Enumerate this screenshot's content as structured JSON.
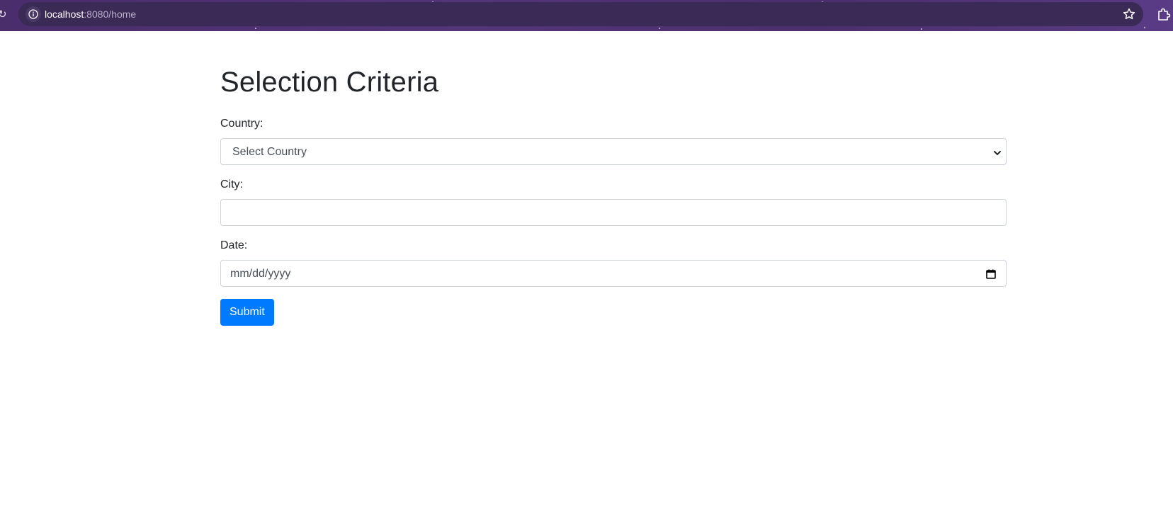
{
  "browser": {
    "url_host": "localhost",
    "url_rest": ":8080/home",
    "icons": {
      "reload": "reload-icon",
      "site_info": "info-icon",
      "bookmark": "star-icon",
      "extensions": "puzzle-icon"
    },
    "theme_color": "#4a2d6b"
  },
  "page": {
    "title": "Selection Criteria",
    "form": {
      "country": {
        "label": "Country:",
        "selected": "Select Country"
      },
      "city": {
        "label": "City:",
        "value": ""
      },
      "date": {
        "label": "Date:",
        "placeholder": "mm/dd/yyyy"
      },
      "submit_label": "Submit"
    },
    "colors": {
      "primary": "#007bff",
      "text": "#212529",
      "border": "#ced4da"
    }
  }
}
